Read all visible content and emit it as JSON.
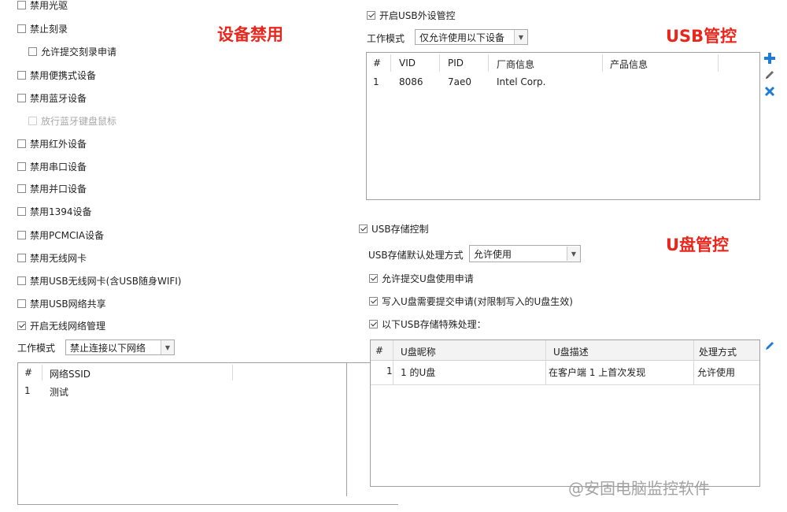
{
  "titles": {
    "device_disable": "设备禁用",
    "usb_control": "USB管控",
    "udisk_control": "U盘管控"
  },
  "left": {
    "checkboxes": [
      {
        "label": "禁用光驱",
        "checked": false
      },
      {
        "label": "禁止刻录",
        "checked": false
      },
      {
        "label": "允许提交刻录申请",
        "checked": false
      },
      {
        "label": "禁用便携式设备",
        "checked": false
      },
      {
        "label": "禁用蓝牙设备",
        "checked": false
      },
      {
        "label": "放行蓝牙键盘鼠标",
        "checked": false,
        "disabled": true
      },
      {
        "label": "禁用红外设备",
        "checked": false
      },
      {
        "label": "禁用串口设备",
        "checked": false
      },
      {
        "label": "禁用并口设备",
        "checked": false
      },
      {
        "label": "禁用1394设备",
        "checked": false
      },
      {
        "label": "禁用PCMCIA设备",
        "checked": false
      },
      {
        "label": "禁用无线网卡",
        "checked": false
      },
      {
        "label": "禁用USB无线网卡(含USB随身WIFI)",
        "checked": false
      },
      {
        "label": "禁用USB网络共享",
        "checked": false
      },
      {
        "label": "开启无线网络管理",
        "checked": true
      }
    ],
    "work_mode_label": "工作模式",
    "work_mode_value": "禁止连接以下网络",
    "table": {
      "headers": [
        "#",
        "网络SSID"
      ],
      "rows": [
        [
          "1",
          "测试"
        ]
      ]
    }
  },
  "usb": {
    "enable_label": "开启USB外设管控",
    "enable_checked": true,
    "work_mode_label": "工作模式",
    "work_mode_value": "仅允许使用以下设备",
    "table": {
      "headers": [
        "#",
        "VID",
        "PID",
        "厂商信息",
        "产品信息"
      ],
      "rows": [
        [
          "1",
          "8086",
          "7ae0",
          "Intel Corp.",
          ""
        ]
      ]
    },
    "icons": [
      "add-icon",
      "edit-icon",
      "delete-icon"
    ]
  },
  "storage": {
    "enable_label": "USB存储控制",
    "enable_checked": true,
    "default_label": "USB存储默认处理方式",
    "default_value": "允许使用",
    "options": [
      {
        "label": "允许提交U盘使用申请",
        "checked": true
      },
      {
        "label": "写入U盘需要提交申请(对限制写入的U盘生效)",
        "checked": true
      },
      {
        "label": "以下USB存储特殊处理：",
        "checked": true
      }
    ],
    "table": {
      "headers": [
        "#",
        "U盘昵称",
        "U盘描述",
        "处理方式"
      ],
      "rows": [
        [
          "1",
          "1 的U盘",
          "在客户端 1 上首次发现",
          "允许使用"
        ]
      ]
    }
  },
  "watermark": "@安固电脑监控软件",
  "colors": {
    "title_red": "#e8261c",
    "icon_blue": "#1e7bd6"
  }
}
